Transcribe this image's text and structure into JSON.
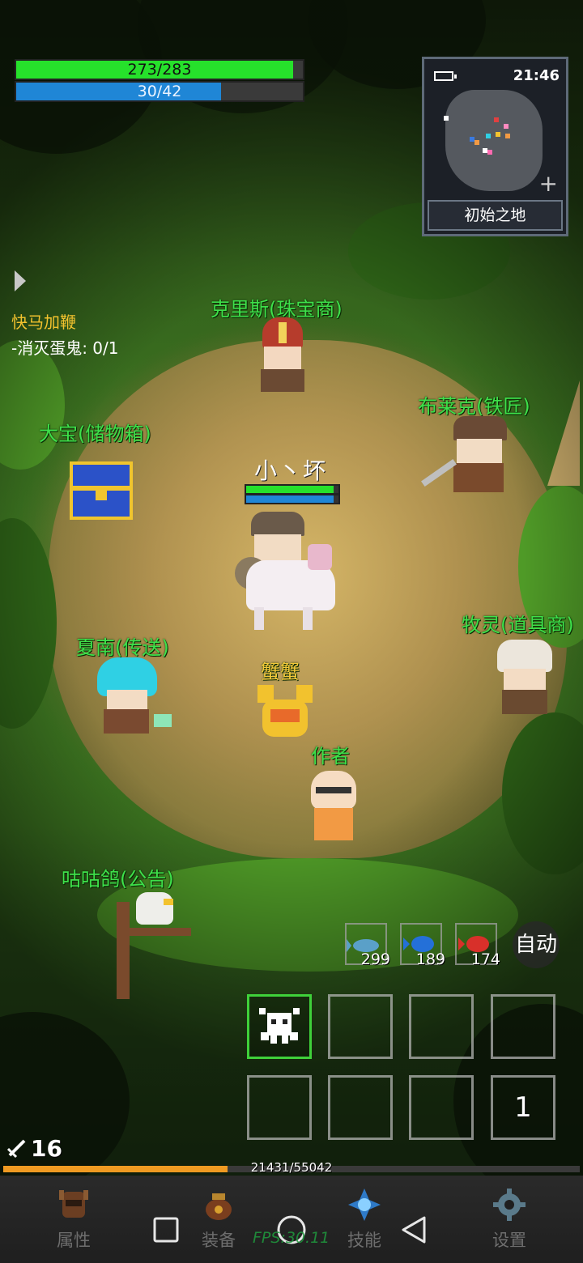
{
  "hud": {
    "hp_text": "273/283",
    "hp_fraction": 0.965,
    "mp_text": "30/42",
    "mp_fraction": 0.714
  },
  "minimap": {
    "time": "21:46",
    "location": "初始之地",
    "zoom_icon": "plus-icon"
  },
  "quest": {
    "title": "快马加鞭",
    "objective": "-消灭蛋鬼: 0/1",
    "toggle_icon": "triangle-right-icon"
  },
  "npcs": {
    "jeweler": "克里斯(珠宝商)",
    "blacksmith": "布莱克(铁匠)",
    "storage": "大宝(储物箱)",
    "teleport": "夏南(传送)",
    "item_shop": "牧灵(道具商)",
    "author": "作者",
    "announcement": "咕咕鸽(公告)"
  },
  "player": {
    "name": "小丶坏",
    "hp_fraction": 0.95,
    "mp_fraction": 0.95
  },
  "pet": {
    "name": "蟹蟹"
  },
  "items": [
    {
      "name": "fish-icon",
      "count": "299",
      "color": "#5aa0c8"
    },
    {
      "name": "blue-fish-icon",
      "count": "189",
      "color": "#2470d8"
    },
    {
      "name": "red-fish-icon",
      "count": "174",
      "color": "#d8302a"
    }
  ],
  "auto_button": "自动",
  "skills": {
    "slot8_count": "1"
  },
  "level": {
    "value": "16"
  },
  "exp": {
    "text": "21431/55042",
    "fraction": 0.389
  },
  "nav": {
    "attributes": "属性",
    "equipment": "装备",
    "skills": "技能",
    "settings": "设置"
  },
  "fps": "FPS:30.11",
  "colors": {
    "hp": "#26e12b",
    "mp": "#1f86d6",
    "npc_name": "#3ee04a",
    "pet_name": "#f3c93a",
    "exp": "#ef9a22"
  }
}
